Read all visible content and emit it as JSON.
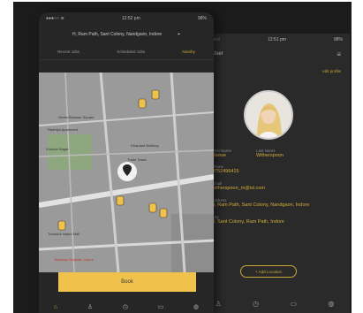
{
  "front": {
    "status": {
      "signal": "●●●○○ ≋",
      "time": "12:52 pm",
      "battery": "98%"
    },
    "address": "H, Ram Path, Sant Colony, Nandgaon, Indore",
    "tabs": [
      "Recent Jobs",
      "Scheduled Jobs",
      "Nearby"
    ],
    "active_tab": 2,
    "map_labels": {
      "label1": "Geeta Bhawan Square",
      "label2": "Radhiya Apartment",
      "label3": "Dhapaad Building",
      "label4": "Trade Tower",
      "label5": "Krishna Nagar",
      "label6": "Treasure Island Mall",
      "label7": "Bombay Hospital, Indore"
    },
    "book_label": "Book",
    "bottom_nav": [
      "⌂",
      "♙",
      "◷",
      "▭",
      "◍"
    ]
  },
  "back": {
    "status": {
      "time": "12:51 pm",
      "battery": "98%"
    },
    "title": "User",
    "edit_link": "edit profile",
    "fields": {
      "first_name_label": "First Name",
      "first_name": "Reese",
      "last_name_label": "Last Name",
      "last_name": "Witherspoon",
      "phone_label": "Phone",
      "phone": "9752496415",
      "email_label": "Email",
      "email": "witherspoon_m@isl.com",
      "address_label": "Address",
      "address": "4, Ram Path, Sant Colony, Nandgaon, Indore",
      "city_label": "City",
      "city": "4, Sant Colony, Ram Path, Indore"
    },
    "add_location": "+ Add Location",
    "bottom_nav": [
      "♙",
      "◷",
      "▭",
      "◍"
    ]
  },
  "colors": {
    "accent": "#c9a634",
    "button": "#f0c24b",
    "frame": "#1b1b1b"
  }
}
